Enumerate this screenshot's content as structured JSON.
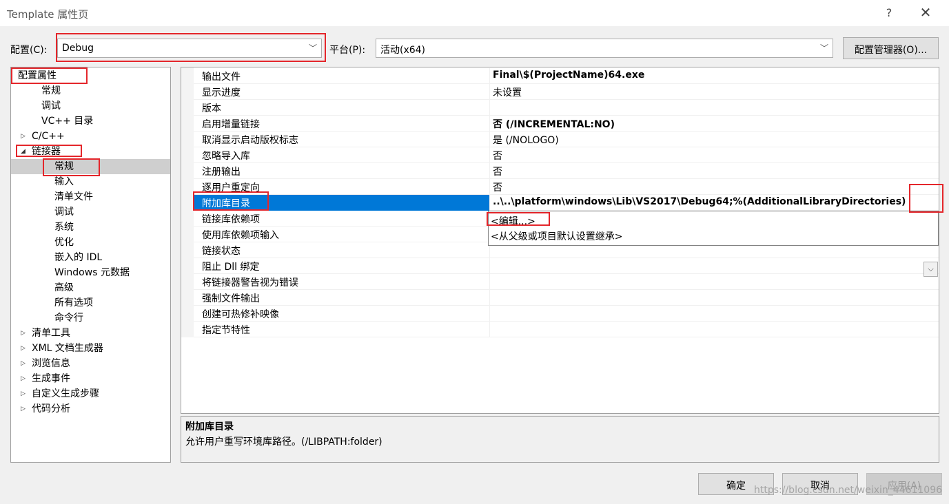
{
  "window": {
    "title": "Template 属性页",
    "help_glyph": "?",
    "close_glyph": "✕"
  },
  "toolbar": {
    "config_label": "配置(C):",
    "config_value": "Debug",
    "platform_label": "平台(P):",
    "platform_value": "活动(x64)",
    "config_manager_button": "配置管理器(O)..."
  },
  "tree": {
    "items": [
      {
        "label": "配置属性",
        "expander": "◢"
      },
      {
        "label": "常规"
      },
      {
        "label": "调试"
      },
      {
        "label": "VC++ 目录"
      },
      {
        "label": "C/C++",
        "expander": "▷"
      },
      {
        "label": "链接器",
        "expander": "◢"
      },
      {
        "label": "常规",
        "selected": true
      },
      {
        "label": "输入"
      },
      {
        "label": "清单文件"
      },
      {
        "label": "调试"
      },
      {
        "label": "系统"
      },
      {
        "label": "优化"
      },
      {
        "label": "嵌入的 IDL"
      },
      {
        "label": "Windows 元数据"
      },
      {
        "label": "高级"
      },
      {
        "label": "所有选项"
      },
      {
        "label": "命令行"
      },
      {
        "label": "清单工具",
        "expander": "▷"
      },
      {
        "label": "XML 文档生成器",
        "expander": "▷"
      },
      {
        "label": "浏览信息",
        "expander": "▷"
      },
      {
        "label": "生成事件",
        "expander": "▷"
      },
      {
        "label": "自定义生成步骤",
        "expander": "▷"
      },
      {
        "label": "代码分析",
        "expander": "▷"
      }
    ]
  },
  "grid": {
    "rows": [
      {
        "name": "输出文件",
        "value": "Final\\$(ProjectName)64.exe",
        "bold": true
      },
      {
        "name": "显示进度",
        "value": "未设置"
      },
      {
        "name": "版本",
        "value": ""
      },
      {
        "name": "启用增量链接",
        "value": "否 (/INCREMENTAL:NO)",
        "bold": true
      },
      {
        "name": "取消显示启动版权标志",
        "value": "是 (/NOLOGO)"
      },
      {
        "name": "忽略导入库",
        "value": "否"
      },
      {
        "name": "注册输出",
        "value": "否"
      },
      {
        "name": "逐用户重定向",
        "value": "否"
      },
      {
        "name": "附加库目录",
        "value": "..\\..\\platform\\windows\\Lib\\VS2017\\Debug64;%(AdditionalLibraryDirectories)",
        "bold": true,
        "selected": true
      },
      {
        "name": "链接库依赖项",
        "value": ""
      },
      {
        "name": "使用库依赖项输入",
        "value": ""
      },
      {
        "name": "链接状态",
        "value": ""
      },
      {
        "name": "阻止 Dll 绑定",
        "value": ""
      },
      {
        "name": "将链接器警告视为错误",
        "value": ""
      },
      {
        "name": "强制文件输出",
        "value": ""
      },
      {
        "name": "创建可热修补映像",
        "value": ""
      },
      {
        "name": "指定节特性",
        "value": ""
      }
    ],
    "dropdown_options": [
      "<编辑...>",
      "<从父级或项目默认设置继承>"
    ],
    "dropdown_glyph": "⌵"
  },
  "description": {
    "title": "附加库目录",
    "text": "允许用户重写环境库路径。(/LIBPATH:folder)"
  },
  "buttons": {
    "ok": "确定",
    "cancel": "取消",
    "apply": "应用(A)"
  },
  "watermark": "https://blog.csdn.net/weixin_44611096",
  "colors": {
    "selection_blue": "#0078d7",
    "annotation_red": "#e4262b",
    "tree_selection_gray": "#cfcfcf"
  }
}
